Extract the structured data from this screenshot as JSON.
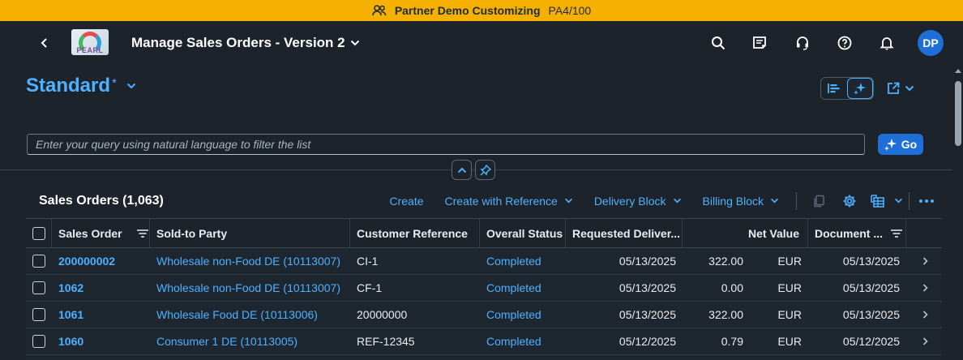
{
  "banner": {
    "icon": "users-icon",
    "title": "Partner Demo Customizing",
    "system": "PA4/100",
    "color": "#f5b000"
  },
  "shell": {
    "logo_text": "PEARL",
    "app_title": "Manage Sales Orders - Version 2",
    "icons": [
      "search-icon",
      "notes-icon",
      "headset-icon",
      "help-icon",
      "bell-icon"
    ],
    "avatar": "DP"
  },
  "variant": {
    "name": "Standard",
    "modified_marker": "*"
  },
  "filter": {
    "placeholder": "Enter your query using natural language to filter the list",
    "go_label": "Go"
  },
  "table": {
    "title": "Sales Orders (1,063)",
    "actions": [
      "Create",
      "Create with Reference",
      "Delivery Block",
      "Billing Block"
    ],
    "columns": [
      "Sales Order",
      "Sold-to Party",
      "Customer Reference",
      "Overall Status",
      "Requested Deliver...",
      "Net Value",
      "Document ..."
    ],
    "rows": [
      {
        "order": "200000002",
        "party": "Wholesale non-Food DE (10113007)",
        "ref": "CI-1",
        "status": "Completed",
        "req_date": "05/13/2025",
        "net": "322.00",
        "currency": "EUR",
        "doc_date": "05/13/2025"
      },
      {
        "order": "1062",
        "party": "Wholesale non-Food DE (10113007)",
        "ref": "CF-1",
        "status": "Completed",
        "req_date": "05/13/2025",
        "net": "0.00",
        "currency": "EUR",
        "doc_date": "05/13/2025"
      },
      {
        "order": "1061",
        "party": "Wholesale Food DE (10113006)",
        "ref": "20000000",
        "status": "Completed",
        "req_date": "05/13/2025",
        "net": "322.00",
        "currency": "EUR",
        "doc_date": "05/13/2025"
      },
      {
        "order": "1060",
        "party": "Consumer 1 DE (10113005)",
        "ref": "REF-12345",
        "status": "Completed",
        "req_date": "05/12/2025",
        "net": "0.79",
        "currency": "EUR",
        "doc_date": "05/12/2025"
      }
    ]
  },
  "colors": {
    "accent": "#4db1ff",
    "button": "#1f6fd8",
    "background": "#1d232a"
  }
}
